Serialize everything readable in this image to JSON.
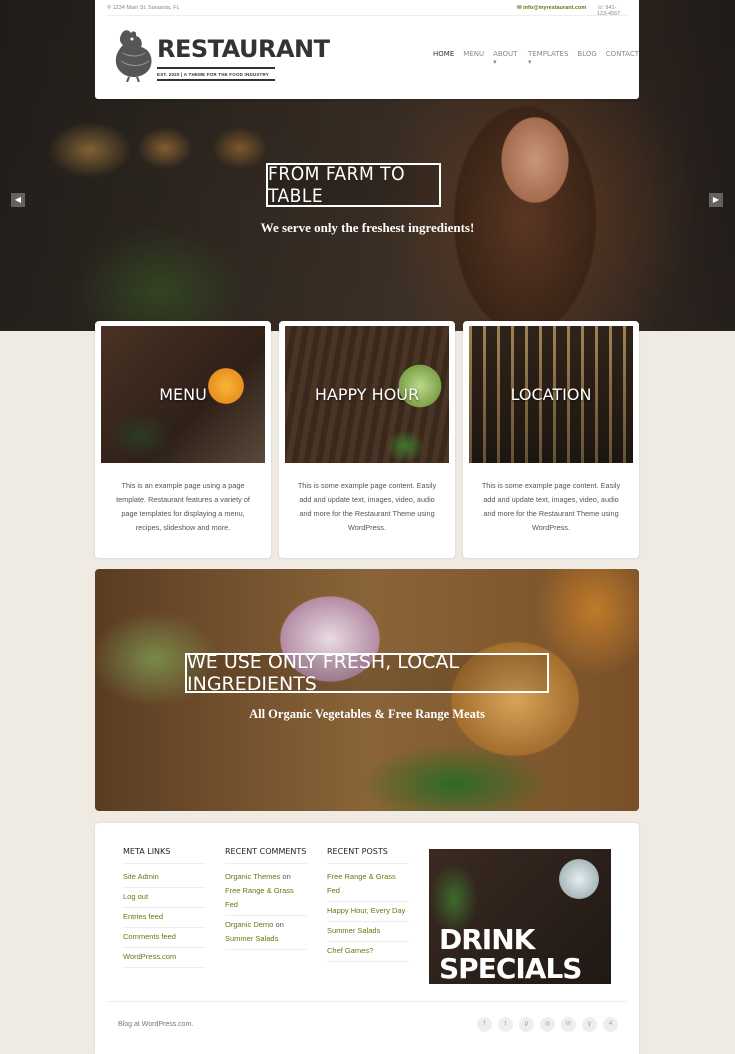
{
  "topbar": {
    "address": "1234 Main St. Sarasota, FL",
    "email": "info@myrestaurant.com",
    "phone": "941-123-4567"
  },
  "logo": {
    "word": "RESTAURANT",
    "tagline": "EST. 2020 | A THEME FOR THE FOOD INDUSTRY"
  },
  "nav": [
    "HOME",
    "MENU",
    "ABOUT ▾",
    "TEMPLATES ▾",
    "BLOG",
    "CONTACT"
  ],
  "hero": {
    "title": "FROM FARM TO TABLE",
    "subtitle": "We serve only the freshest ingredients!",
    "prev": "◀",
    "next": "▶"
  },
  "cards": [
    {
      "title": "MENU",
      "text": "This is an example page using a page template. Restaurant features a variety of page templates for displaying a menu, recipes, slideshow and more."
    },
    {
      "title": "HAPPY HOUR",
      "text": "This is some example page content. Easily add and update text, images, video, audio and more for the Restaurant Theme using WordPress."
    },
    {
      "title": "LOCATION",
      "text": "This is some example page content. Easily add and update text, images, video, audio and more for the Restaurant Theme using WordPress."
    }
  ],
  "banner": {
    "title": "WE USE ONLY FRESH, LOCAL INGREDIENTS",
    "subtitle": "All Organic Vegetables & Free Range Meats"
  },
  "widgets": {
    "meta": {
      "title": "META LINKS",
      "items": [
        "Site Admin",
        "Log out",
        "Entries feed",
        "Comments feed",
        "WordPress.com"
      ]
    },
    "comments": {
      "title": "RECENT COMMENTS"
    },
    "comment1": {
      "author": "Organic Themes",
      "on": "on",
      "post": "Free Range & Grass Fed"
    },
    "comment2": {
      "author": "Organic Demo",
      "on": "on",
      "post": "Summer Salads"
    },
    "posts": {
      "title": "RECENT POSTS",
      "items": [
        "Free Range & Grass Fed",
        "Happy Hour, Every Day",
        "Summer Salads",
        "Chef Games?"
      ]
    }
  },
  "drink": {
    "line1": "DRINK",
    "line2": "SPECIALS"
  },
  "footer": {
    "credit": "Blog at WordPress.com.",
    "social": [
      "f",
      "t",
      "p",
      "◎",
      "in",
      "y",
      "4"
    ]
  }
}
